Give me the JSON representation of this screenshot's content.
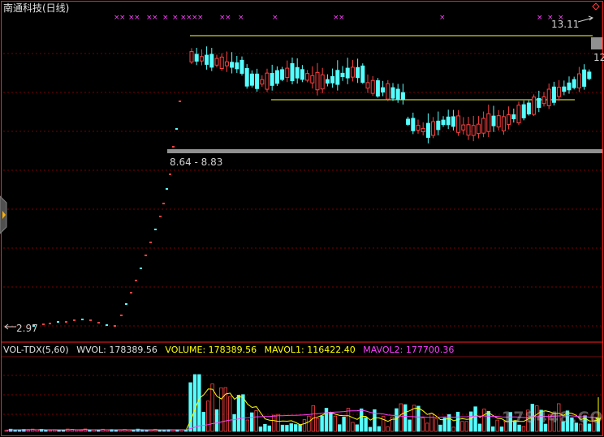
{
  "window": {
    "title": "南通科技(日线)"
  },
  "price_chart": {
    "high_marker": "13.11",
    "low_marker": "2.97",
    "range_label": "8.64 - 8.83",
    "right_edge_label": "12",
    "signal_marker": "×"
  },
  "volume_panel": {
    "indicator": "VOL-TDX(5,60)",
    "wvol": "WVOL: 178389.56",
    "volume": "VOLUME: 178389.56",
    "mavol1": "MAVOL1: 116422.40",
    "mavol2": "MAVOL2: 177700.36"
  },
  "colors": {
    "up": "#ff4040",
    "down": "#54ffff",
    "frame": "#ff2020",
    "grid": "#7a0000",
    "mavol1": "#ffff00",
    "mavol2": "#ff40ff",
    "support_line": "#ffff40",
    "gap_bar": "#909090",
    "volume_label": "#ffff00",
    "mavol2_label": "#ff40ff",
    "wvol_label": "#e0e0e0"
  },
  "watermark": "178448.COM",
  "icons": {
    "side_tab": "expand-arrow-icon"
  }
}
